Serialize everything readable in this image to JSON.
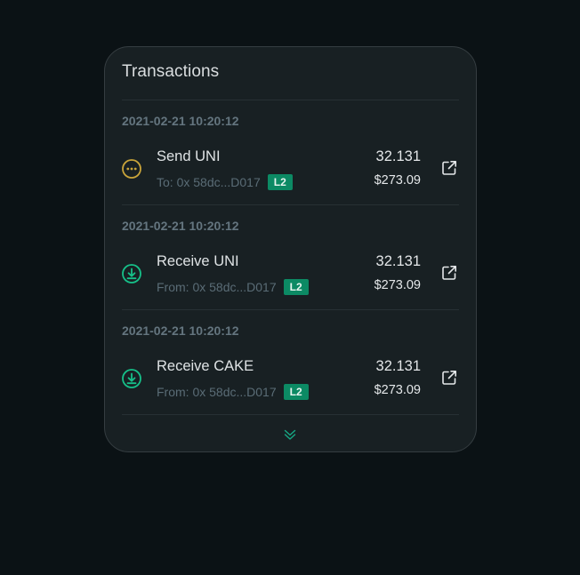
{
  "card": {
    "title": "Transactions"
  },
  "transactions": [
    {
      "date": "2021-02-21 10:20:12",
      "title": "Send UNI",
      "address_label": "To: 0x 58dc...D017",
      "badge": "L2",
      "amount": "32.131",
      "fiat": "$273.09",
      "status_icon": "pending-icon"
    },
    {
      "date": "2021-02-21 10:20:12",
      "title": "Receive UNI",
      "address_label": "From: 0x 58dc...D017",
      "badge": "L2",
      "amount": "32.131",
      "fiat": "$273.09",
      "status_icon": "receive-icon"
    },
    {
      "date": "2021-02-21 10:20:12",
      "title": "Receive CAKE",
      "address_label": "From: 0x 58dc...D017",
      "badge": "L2",
      "amount": "32.131",
      "fiat": "$273.09",
      "status_icon": "receive-icon"
    }
  ],
  "colors": {
    "background": "#0b1215",
    "card": "#182023",
    "pending": "#c9a43a",
    "receive": "#16c089",
    "badge": "#0c8a64",
    "muted_text": "#64757f"
  },
  "icons": {
    "external_link": "external-link-icon",
    "expand_more": "chevron-double-down-icon"
  }
}
